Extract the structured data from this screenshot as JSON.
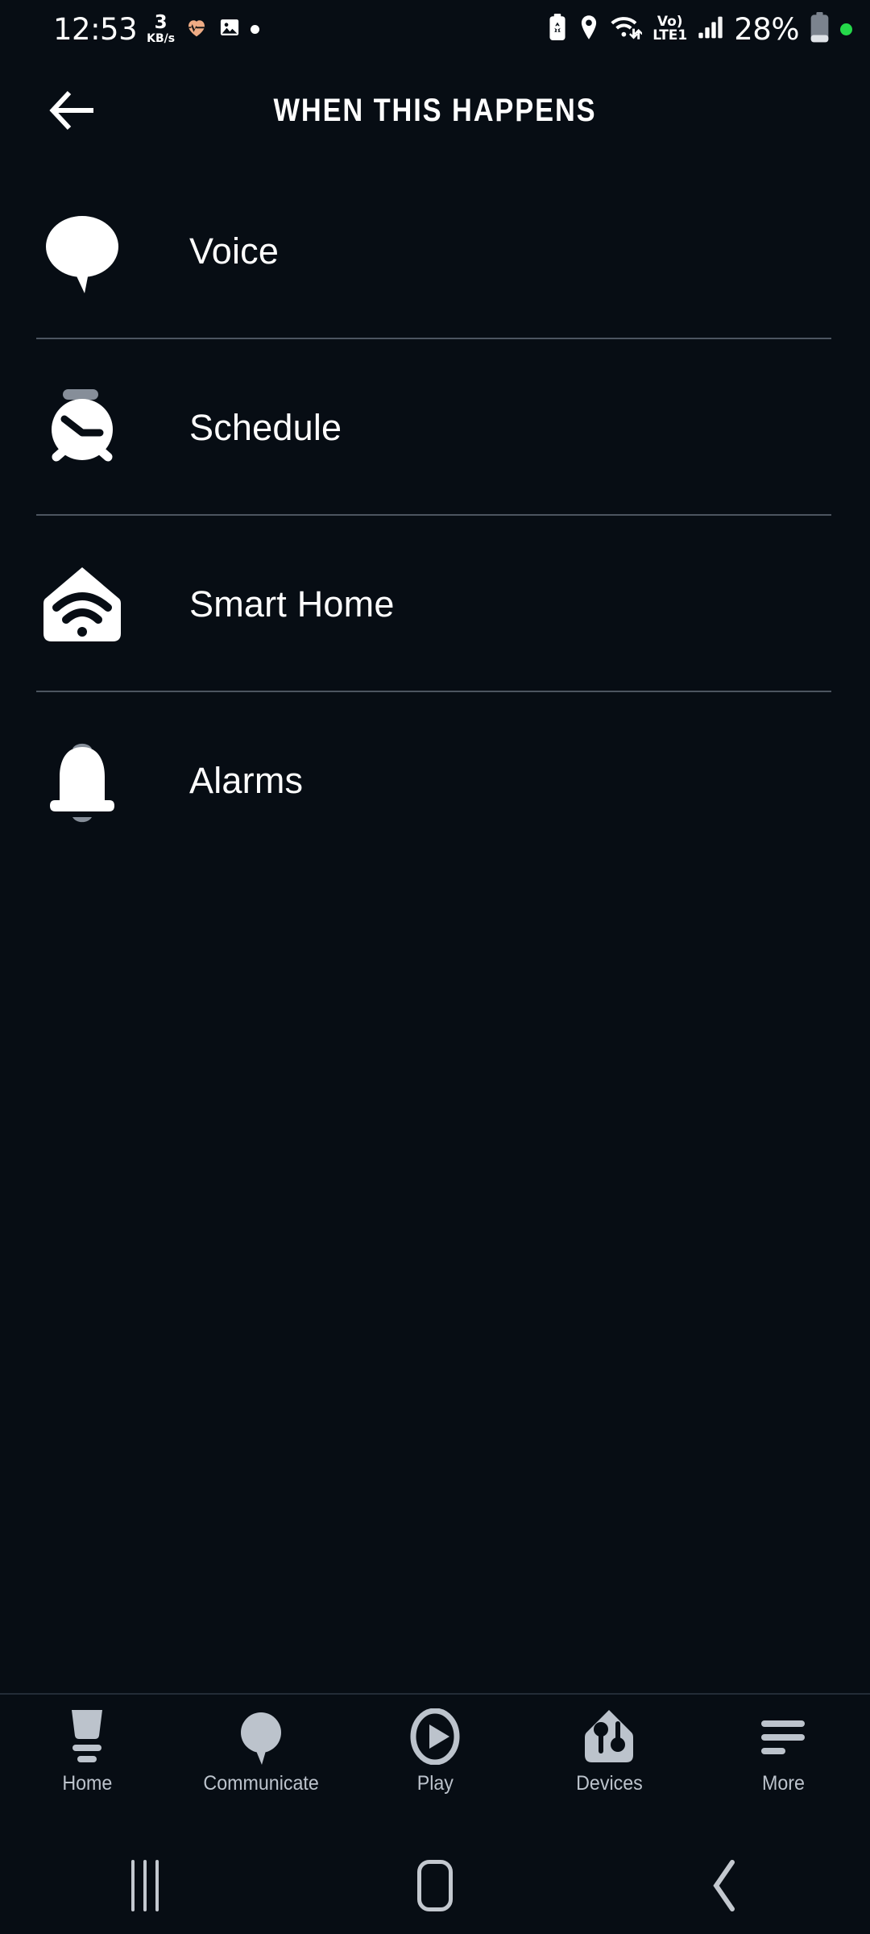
{
  "status_bar": {
    "time": "12:53",
    "net_speed_value": "3",
    "net_speed_unit": "KB/s",
    "icons_left": [
      "heart-rate-icon",
      "image-icon",
      "dot-indicator-icon"
    ],
    "battery_saver_icon": "battery-recycle-icon",
    "location_icon": "location-pin-icon",
    "wifi_icon": "wifi-transfer-icon",
    "volte_line1": "Vo)",
    "volte_line2": "LTE1",
    "signal_icon": "cellular-signal-icon",
    "battery_percent": "28%",
    "battery_icon": "battery-icon",
    "recording_dot": "green-dot-icon"
  },
  "app_bar": {
    "back_icon": "arrow-left-icon",
    "title": "WHEN THIS HAPPENS"
  },
  "list": {
    "items": [
      {
        "label": "Voice",
        "icon": "speech-bubble-icon"
      },
      {
        "label": "Schedule",
        "icon": "alarm-clock-icon"
      },
      {
        "label": "Smart Home",
        "icon": "house-wifi-icon"
      },
      {
        "label": "Alarms",
        "icon": "bell-icon"
      }
    ]
  },
  "bottom_nav": {
    "items": [
      {
        "label": "Home",
        "icon": "echo-device-icon"
      },
      {
        "label": "Communicate",
        "icon": "speech-bubble-icon"
      },
      {
        "label": "Play",
        "icon": "play-circle-icon"
      },
      {
        "label": "Devices",
        "icon": "house-controls-icon"
      },
      {
        "label": "More",
        "icon": "hamburger-menu-icon"
      }
    ]
  },
  "android_nav": {
    "recents": "recents-icon",
    "home": "home-icon",
    "back": "back-chevron-icon"
  },
  "colors": {
    "background": "#070d14",
    "icon_white": "#ffffff",
    "icon_gray": "#868e99",
    "divider": "#4c5560",
    "nav_inactive": "#bcc3cc",
    "accent_green": "#25d84a",
    "heart_icon": "#efac85"
  }
}
